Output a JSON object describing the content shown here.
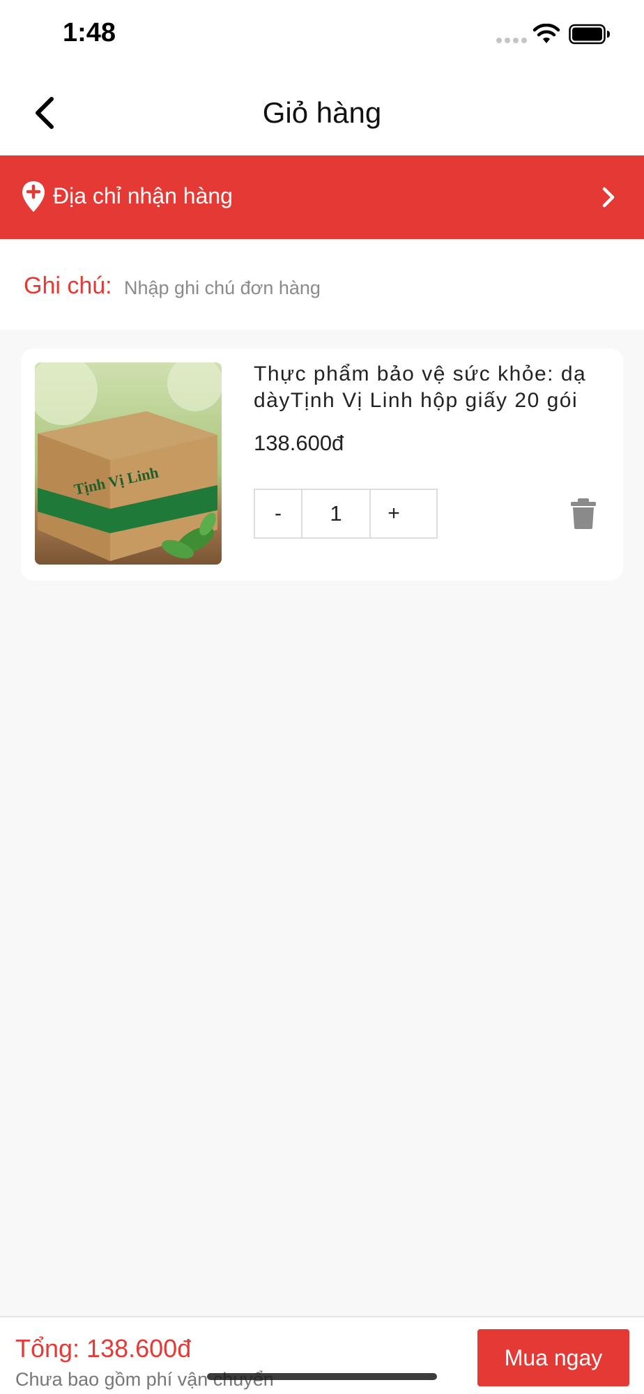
{
  "status_bar": {
    "time": "1:48"
  },
  "header": {
    "title": "Giỏ hàng"
  },
  "address": {
    "label": "Địa chỉ nhận hàng"
  },
  "note": {
    "label": "Ghi chú:",
    "placeholder": "Nhập ghi chú đơn hàng",
    "value": ""
  },
  "cart": {
    "items": [
      {
        "name": "Thực phẩm bảo vệ sức khỏe: dạ dàyTịnh Vị Linh hộp giấy 20 gói",
        "price": "138.600đ",
        "quantity": "1",
        "minus_label": "-",
        "plus_label": "+",
        "image_text": "Tịnh Vị Linh"
      }
    ]
  },
  "footer": {
    "total": "Tổng: 138.600đ",
    "shipping_note": "Chưa bao gồm phí vận chuyển",
    "buy_label": "Mua ngay"
  },
  "colors": {
    "accent": "#e53935",
    "background": "#f8f8f8"
  },
  "icons": [
    "back-icon",
    "pin-icon",
    "chevron-right-icon",
    "trash-icon",
    "wifi-icon",
    "battery-icon"
  ]
}
